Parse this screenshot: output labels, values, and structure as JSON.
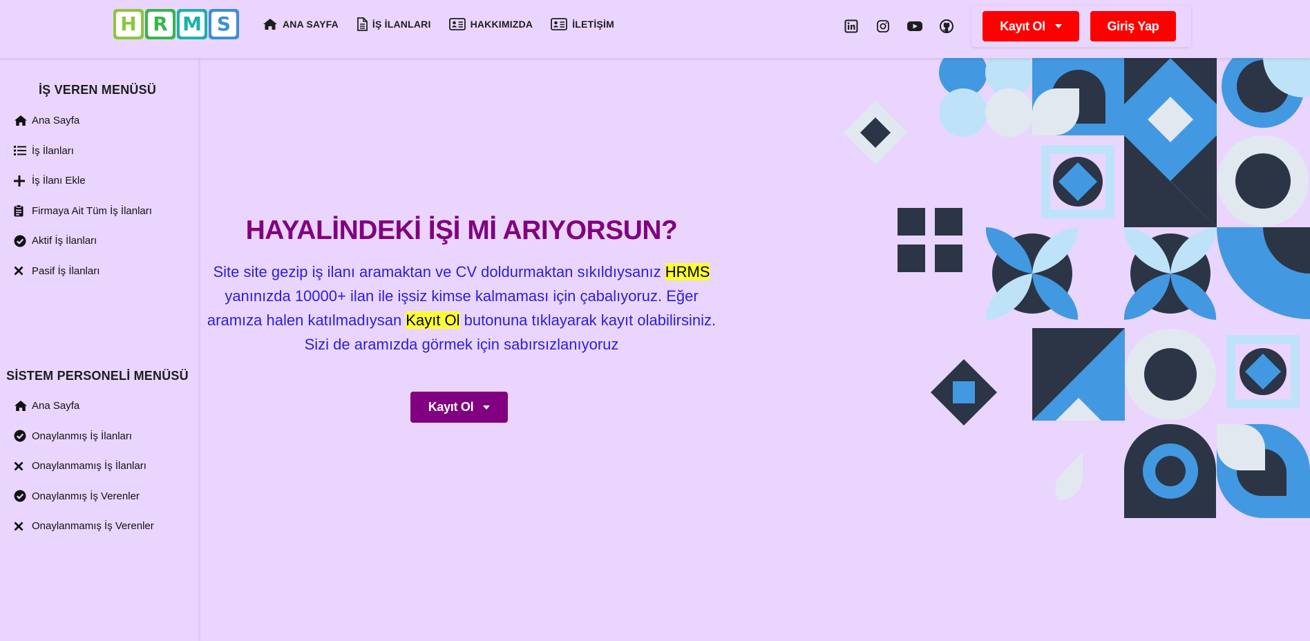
{
  "logo": {
    "letters": [
      "H",
      "R",
      "M",
      "S"
    ],
    "colors": [
      "#8dc63f",
      "#39b54a",
      "#1bb3a6",
      "#3c8ed6"
    ]
  },
  "nav": {
    "items": [
      {
        "label": "ANA SAYFA",
        "icon": "home-icon"
      },
      {
        "label": "İŞ İLANLARI",
        "icon": "file-icon"
      },
      {
        "label": "HAKKIMIZDA",
        "icon": "id-card-icon"
      },
      {
        "label": "İLETİŞİM",
        "icon": "id-card-icon"
      }
    ],
    "social": [
      "linkedin-icon",
      "instagram-icon",
      "youtube-icon",
      "github-icon"
    ],
    "register_label": "Kayıt Ol",
    "login_label": "Giriş Yap"
  },
  "sidebar": {
    "employer_title": "İŞ VEREN MENÜSÜ",
    "employer_items": [
      {
        "label": "Ana Sayfa",
        "icon": "home-icon"
      },
      {
        "label": "İş İlanları",
        "icon": "list-icon"
      },
      {
        "label": "İş İlanı Ekle",
        "icon": "plus-icon"
      },
      {
        "label": "Firmaya Ait Tüm İş İlanları",
        "icon": "clipboard-icon"
      },
      {
        "label": "Aktif İş İlanları",
        "icon": "check-circle-icon"
      },
      {
        "label": "Pasif İş İlanları",
        "icon": "x-icon"
      }
    ],
    "staff_title": "SİSTEM PERSONELİ MENÜSÜ",
    "staff_items": [
      {
        "label": "Ana Sayfa",
        "icon": "home-icon"
      },
      {
        "label": "Onaylanmış İş İlanları",
        "icon": "check-circle-icon"
      },
      {
        "label": "Onaylanmamış İş İlanları",
        "icon": "x-icon"
      },
      {
        "label": "Onaylanmış İş Verenler",
        "icon": "check-circle-icon"
      },
      {
        "label": "Onaylanmamış İş Verenler",
        "icon": "x-icon"
      }
    ]
  },
  "hero": {
    "title": "HAYALİNDEKİ İŞİ Mİ ARIYORSUN?",
    "text_part1": "Site site gezip iş ilanı aramaktan ve CV doldurmaktan sıkıldıysanız ",
    "highlight1": "HRMS",
    "text_part2": " yanınızda 10000+ ilan ile işsiz kimse kalmaması için çabalıyoruz. Eğer aramıza halen katılmadıysan ",
    "highlight2": "Kayıt Ol",
    "text_part3": " butonuna tıklayarak kayıt olabilirsiniz. Sizi de aramızda görmek için sabırsızlanıyoruz",
    "button_label": "Kayıt Ol"
  },
  "colors": {
    "background": "#ead5fe",
    "accent_purple": "#800080",
    "text_blue": "#2c20d8",
    "button_red": "#ff0000",
    "highlight": "#ffff33",
    "deco_dark": "#2b3546",
    "deco_blue": "#4299e1",
    "deco_light": "#bee3f8",
    "deco_gray": "#e2e8f0"
  }
}
